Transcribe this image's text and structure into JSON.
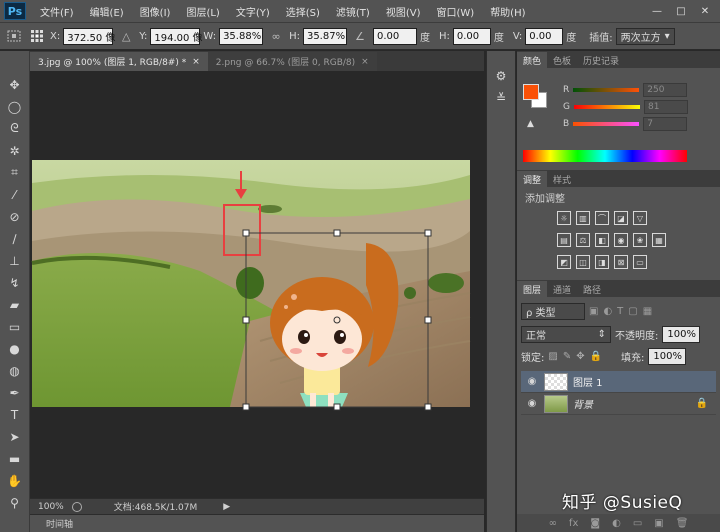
{
  "app": {
    "logo": "Ps"
  },
  "menu": [
    "文件(F)",
    "编辑(E)",
    "图像(I)",
    "图层(L)",
    "文字(Y)",
    "选择(S)",
    "滤镜(T)",
    "视图(V)",
    "窗口(W)",
    "帮助(H)"
  ],
  "window_controls": [
    "—",
    "□",
    "✕"
  ],
  "options": {
    "x_label": "X:",
    "x_value": "372.50 像",
    "y_label": "Y:",
    "y_value": "194.00 像",
    "w_label": "W:",
    "w_value": "35.88%",
    "h_label": "H:",
    "h_value": "35.87%",
    "angle_value": "0.00",
    "angle_unit": "度",
    "hskew_label": "H:",
    "hskew_value": "0.00",
    "hskew_unit": "度",
    "vskew_label": "V:",
    "vskew_value": "0.00",
    "vskew_unit": "度",
    "interp_label": "插值:",
    "interp_value": "两次立方"
  },
  "tabs": [
    {
      "label": "3.jpg @ 100% (图层 1, RGB/8#) *",
      "close": "×"
    },
    {
      "label": "2.png @ 66.7% (图层 0, RGB/8)",
      "close": "×"
    }
  ],
  "status": {
    "zoom": "100%",
    "doc_info": "文档:468.5K/1.07M"
  },
  "timeline_label": "时间轴",
  "color_panel": {
    "tabs": [
      "颜色",
      "色板",
      "历史记录"
    ],
    "r_label": "R",
    "r_value": "250",
    "g_label": "G",
    "g_value": "81",
    "b_label": "B",
    "b_value": "7",
    "foreground": "#fa5107",
    "background": "#ffffff"
  },
  "adjust_panel": {
    "tabs": [
      "调整",
      "样式"
    ],
    "add_label": "添加调整"
  },
  "layers_panel": {
    "tabs": [
      "图层",
      "通道",
      "路径"
    ],
    "filter_label": "ρ 类型",
    "blend_mode": "正常",
    "opacity_label": "不透明度:",
    "opacity_value": "100%",
    "lock_label": "锁定:",
    "fill_label": "填充:",
    "fill_value": "100%",
    "layers": [
      {
        "name": "图层 1",
        "selected": true
      },
      {
        "name": "背景",
        "selected": false
      }
    ]
  },
  "watermark": "知乎 @SusieQ"
}
